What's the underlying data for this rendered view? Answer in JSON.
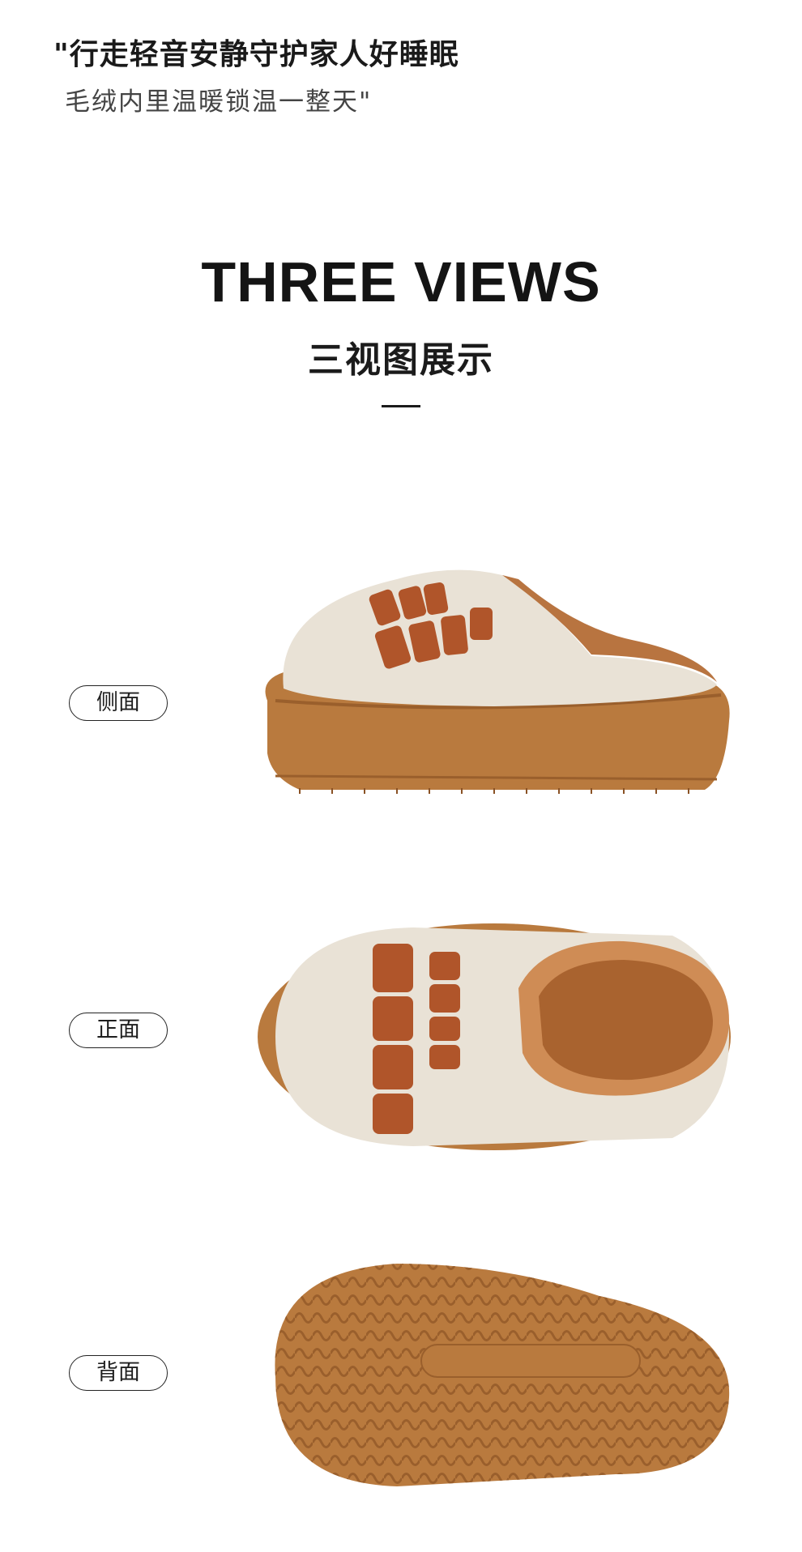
{
  "header": {
    "line1": "\"行走轻音安静守护家人好睡眠",
    "line2": "毛绒内里温暖锁温一整天\""
  },
  "section": {
    "title_en": "THREE VIEWS",
    "title_cn": "三视图展示"
  },
  "views": [
    {
      "label": "侧面",
      "icon": "slipper-side-view"
    },
    {
      "label": "正面",
      "icon": "slipper-top-view"
    },
    {
      "label": "背面",
      "icon": "slipper-sole-view"
    }
  ],
  "colors": {
    "felt": "#e9e2d6",
    "sole": "#b97a3e",
    "sole_dark": "#9a5f2c",
    "lettering": "#b0552a",
    "fleece": "#b87440"
  }
}
